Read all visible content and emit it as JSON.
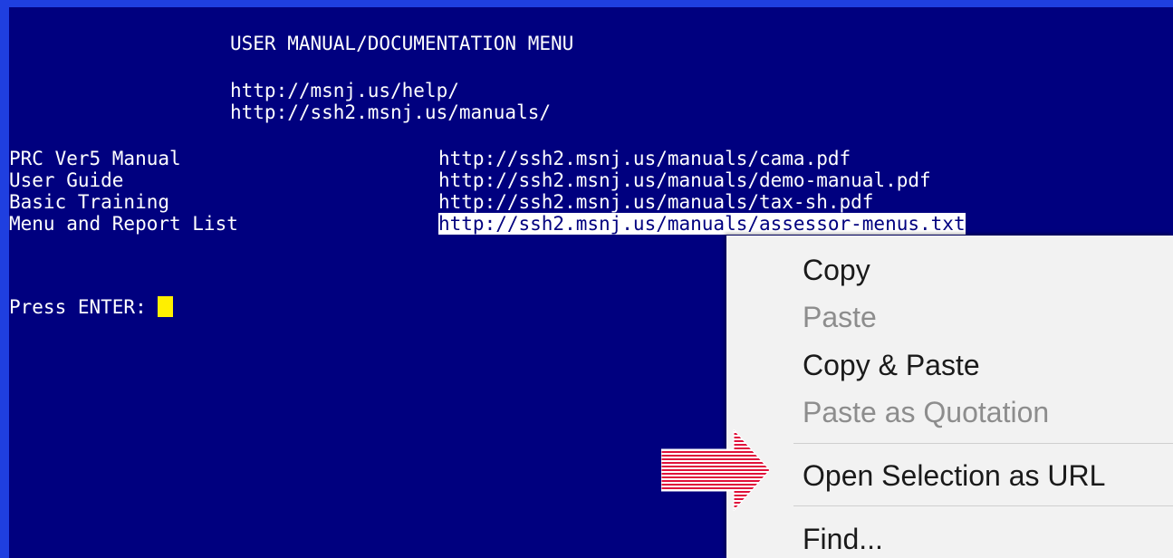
{
  "terminal": {
    "title_line": "USER MANUAL/DOCUMENTATION MENU",
    "url_lines": [
      "http://msnj.us/help/",
      "http://ssh2.msnj.us/manuals/"
    ],
    "entries": [
      {
        "label": "PRC Ver5 Manual",
        "url": "http://ssh2.msnj.us/manuals/cama.pdf"
      },
      {
        "label": "User Guide",
        "url": "http://ssh2.msnj.us/manuals/demo-manual.pdf"
      },
      {
        "label": "Basic Training",
        "url": "http://ssh2.msnj.us/manuals/tax-sh.pdf"
      },
      {
        "label": "Menu and Report List",
        "url": "http://ssh2.msnj.us/manuals/assessor-menus.txt"
      }
    ],
    "prompt": "Press ENTER: "
  },
  "context_menu": {
    "items": [
      {
        "label": "Copy",
        "enabled": true
      },
      {
        "label": "Paste",
        "enabled": false
      },
      {
        "label": "Copy & Paste",
        "enabled": true
      },
      {
        "label": "Paste as Quotation",
        "enabled": false
      },
      {
        "label": "Open Selection as URL",
        "enabled": true
      },
      {
        "label": "Find...",
        "enabled": true
      }
    ]
  },
  "colors": {
    "terminal_bg": "#00007f",
    "frame": "#1f3fe0",
    "cursor": "#ffef00",
    "arrow": "#e0103a",
    "menu_bg": "#f2f2f2"
  }
}
